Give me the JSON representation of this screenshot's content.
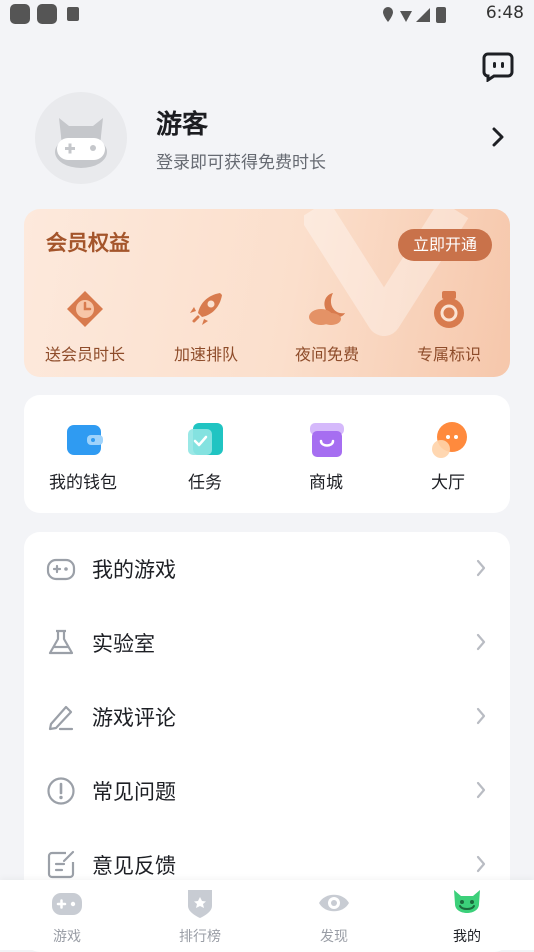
{
  "status_bar": {
    "time": "6:48"
  },
  "profile": {
    "username": "游客",
    "hint": "登录即可获得免费时长"
  },
  "vip": {
    "title": "会员权益",
    "button": "立即开通",
    "items": [
      {
        "label": "送会员时长",
        "icon": "clock-tag-icon"
      },
      {
        "label": "加速排队",
        "icon": "rocket-icon"
      },
      {
        "label": "夜间免费",
        "icon": "moon-cloud-icon"
      },
      {
        "label": "专属标识",
        "icon": "medal-icon"
      }
    ]
  },
  "tools": [
    {
      "label": "我的钱包",
      "icon": "wallet-icon"
    },
    {
      "label": "任务",
      "icon": "task-icon"
    },
    {
      "label": "商城",
      "icon": "shop-icon"
    },
    {
      "label": "大厅",
      "icon": "lobby-chat-icon"
    }
  ],
  "menu": [
    {
      "label": "我的游戏",
      "icon": "gamepad-icon"
    },
    {
      "label": "实验室",
      "icon": "flask-icon"
    },
    {
      "label": "游戏评论",
      "icon": "pencil-icon"
    },
    {
      "label": "常见问题",
      "icon": "exclamation-circle-icon"
    },
    {
      "label": "意见反馈",
      "icon": "feedback-icon"
    }
  ],
  "tabs": [
    {
      "label": "游戏",
      "icon": "game-tab-icon"
    },
    {
      "label": "排行榜",
      "icon": "ranking-shield-icon"
    },
    {
      "label": "发现",
      "icon": "discover-eye-icon"
    },
    {
      "label": "我的",
      "icon": "mine-monster-icon",
      "active": true
    }
  ],
  "colors": {
    "accent_orange": "#c9724a",
    "vip_text": "#a4552b",
    "active_tab": "#3cd07a"
  }
}
